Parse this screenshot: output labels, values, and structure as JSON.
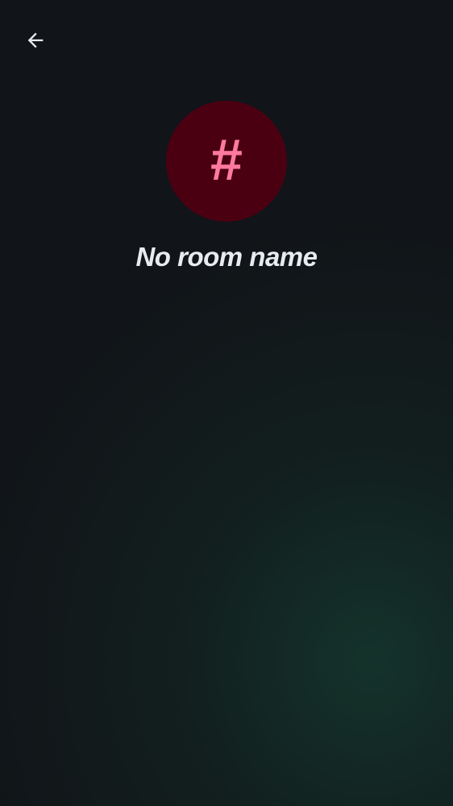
{
  "room": {
    "avatar_glyph": "#",
    "name": "No room name"
  },
  "icons": {
    "back": "arrow-left-icon"
  },
  "colors": {
    "background": "#111418",
    "avatar_background": "#4b0012",
    "avatar_glyph": "#ff7a9c",
    "text_primary": "#e8ebf0",
    "icon": "#e8ebf0"
  }
}
